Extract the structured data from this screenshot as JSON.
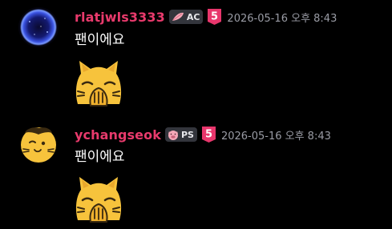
{
  "messages": [
    {
      "username": "rlatjwls3333",
      "tag": "AC",
      "tag_icon": "feather-icon",
      "rank": "5",
      "timestamp": "2026-05-16 오후 8:43",
      "text": "팬이에요",
      "emoji": "cat-facepalm-emoji",
      "avatar": "galaxy-orb-avatar"
    },
    {
      "username": "ychangseok",
      "tag": "PS",
      "tag_icon": "pig-icon",
      "rank": "5",
      "timestamp": "2026-05-16 오후 8:43",
      "text": "팬이에요",
      "emoji": "cat-facepalm-emoji",
      "avatar": "cat-face-avatar"
    }
  ],
  "colors": {
    "background": "#000000",
    "username": "#e83a6c",
    "tag_bg": "#33353c",
    "timestamp": "#9a9ca5",
    "rank_badge": "#e8366c",
    "emoji_yellow": "#f7c33c"
  }
}
